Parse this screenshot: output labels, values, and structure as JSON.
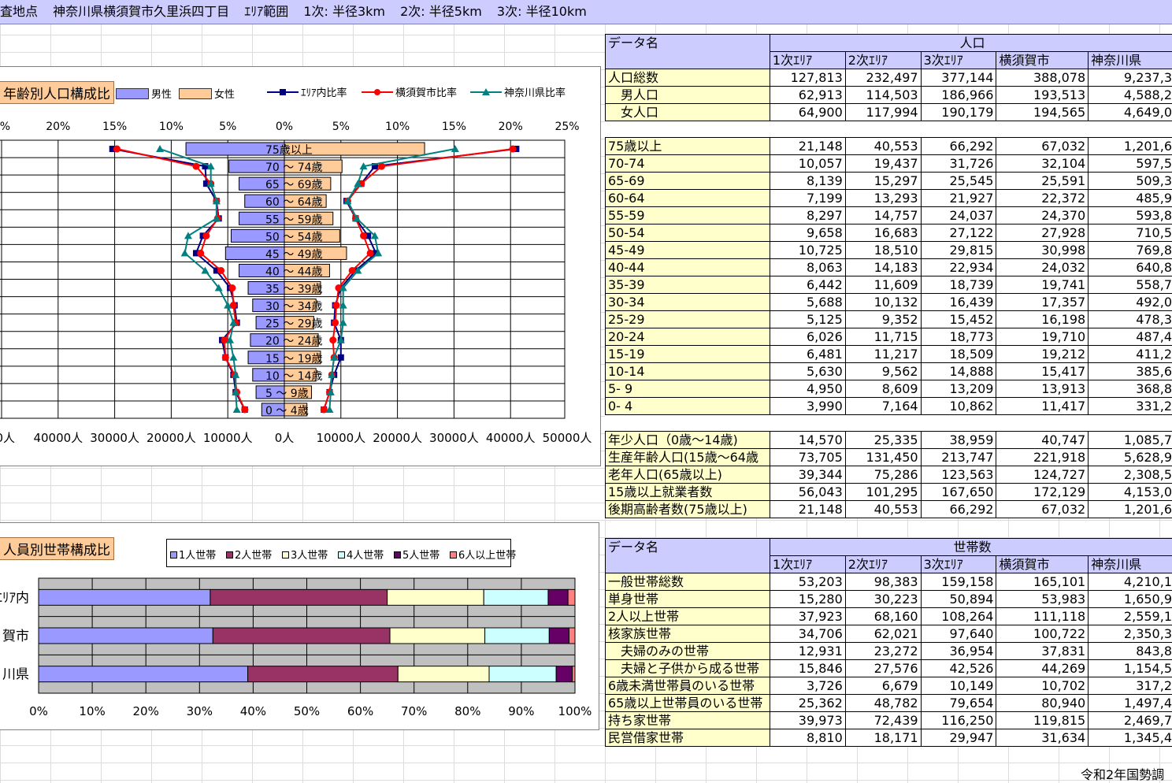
{
  "title": {
    "survey": "査地点",
    "location": "神奈川県横須賀市久里浜四丁目",
    "area_label": "ｴﾘｱ範囲",
    "r1": "1次: 半径3km",
    "r2": "2次: 半径5km",
    "r3": "3次: 半径10km"
  },
  "pyramid": {
    "tag": "年齢別人口構成比",
    "legend": {
      "male": "男性",
      "female": "女性",
      "area_ratio": "ｴﾘｱ内比率",
      "city_ratio": "横須賀市比率",
      "pref_ratio": "神奈川県比率"
    },
    "colors": {
      "male": "#9999ff",
      "female": "#ffcc99",
      "area": "#000080",
      "city": "#ff0000",
      "pref": "#008080"
    },
    "top_ticks": [
      "5%",
      "20%",
      "15%",
      "10%",
      "5%",
      "0%",
      "5%",
      "10%",
      "15%",
      "20%",
      "25%"
    ],
    "bottom_ticks": [
      "00人",
      "40000人",
      "30000人",
      "20000人",
      "10000人",
      "0人",
      "10000人",
      "20000人",
      "30000人",
      "40000人",
      "50000人"
    ],
    "age_labels": [
      "75歳以上",
      "70 ～ 74歳",
      "65 ～ 69歳",
      "60 ～ 64歳",
      "55 ～ 59歳",
      "50 ～ 54歳",
      "45 ～ 49歳",
      "40 ～ 44歳",
      "35 ～ 39歳",
      "30 ～ 34歳",
      "25 ～ 29歳",
      "20 ～ 24歳",
      "15 ～ 19歳",
      "10 ～ 14歳",
      "5 ～ 9歳",
      "0 ～ 4歳"
    ]
  },
  "chart_data": [
    {
      "type": "bar",
      "categories": [
        "75歳以上",
        "70 ～ 74歳",
        "65 ～ 69歳",
        "60 ～ 64歳",
        "55 ～ 59歳",
        "50 ～ 54歳",
        "45 ～ 49歳",
        "40 ～ 44歳",
        "35 ～ 39歳",
        "30 ～ 34歳",
        "25 ～ 29歳",
        "20 ～ 24歳",
        "15 ～ 19歳",
        "10 ～ 14歳",
        "5 ～ 9歳",
        "0 ～ 4歳"
      ],
      "series": [
        {
          "name": "男性",
          "values": [
            8700,
            4900,
            4000,
            3500,
            4000,
            4700,
            5200,
            4000,
            3200,
            2800,
            2500,
            3000,
            3200,
            2800,
            2500,
            2000
          ]
        },
        {
          "name": "女性",
          "values": [
            12400,
            5100,
            4100,
            3700,
            4300,
            4900,
            5500,
            4000,
            3200,
            2800,
            2600,
            3000,
            3200,
            2800,
            2400,
            2000
          ]
        },
        {
          "name": "ｴﾘｱ内比率",
          "values": [
            [
              -15.2,
              20.5
            ],
            [
              -7.0,
              8.0
            ],
            [
              -6.9,
              6.8
            ],
            [
              -6.0,
              5.5
            ],
            [
              -5.8,
              6.3
            ],
            [
              -7.2,
              7.4
            ],
            [
              -7.8,
              8.1
            ],
            [
              -6.0,
              6.3
            ],
            [
              -4.8,
              5.0
            ],
            [
              -4.4,
              4.5
            ],
            [
              -4.2,
              4.4
            ],
            [
              -5.5,
              5.0
            ],
            [
              -5.2,
              5.0
            ],
            [
              -4.5,
              4.4
            ],
            [
              -4.3,
              4.0
            ],
            [
              -3.5,
              3.5
            ]
          ]
        },
        {
          "name": "横須賀市比率",
          "values": [
            [
              -14.8,
              20.2
            ],
            [
              -7.8,
              8.6
            ],
            [
              -6.5,
              6.8
            ],
            [
              -6.0,
              5.6
            ],
            [
              -5.9,
              6.3
            ],
            [
              -6.9,
              7.0
            ],
            [
              -7.4,
              7.6
            ],
            [
              -5.6,
              6.0
            ],
            [
              -4.6,
              4.8
            ],
            [
              -4.5,
              4.6
            ],
            [
              -4.3,
              4.5
            ],
            [
              -5.3,
              4.3
            ],
            [
              -5.2,
              4.4
            ],
            [
              -4.4,
              4.2
            ],
            [
              -4.2,
              4.0
            ],
            [
              -3.5,
              3.5
            ]
          ]
        },
        {
          "name": "神奈川県比率",
          "values": [
            [
              -11.0,
              15.1
            ],
            [
              -6.5,
              7.0
            ],
            [
              -6.5,
              6.5
            ],
            [
              -6.0,
              5.6
            ],
            [
              -6.0,
              6.4
            ],
            [
              -8.5,
              8.0
            ],
            [
              -8.8,
              8.3
            ],
            [
              -7.0,
              6.5
            ],
            [
              -5.8,
              5.2
            ],
            [
              -5.0,
              5.2
            ],
            [
              -4.5,
              5.2
            ],
            [
              -4.8,
              5.0
            ],
            [
              -4.5,
              4.4
            ],
            [
              -4.3,
              4.2
            ],
            [
              -4.3,
              4.1
            ],
            [
              -4.2,
              4.0
            ]
          ]
        }
      ],
      "xlim": [
        -25,
        25
      ],
      "grid": true
    },
    {
      "type": "bar",
      "categories": [
        "ｴﾘｱ内",
        "賀市",
        "川県"
      ],
      "series": [
        {
          "name": "1人世帯",
          "values": [
            32,
            32.5,
            39
          ]
        },
        {
          "name": "2人世帯",
          "values": [
            33,
            33,
            28
          ]
        },
        {
          "name": "3人世帯",
          "values": [
            18,
            17.7,
            17
          ]
        },
        {
          "name": "4人世帯",
          "values": [
            12,
            12,
            12.5
          ]
        },
        {
          "name": "5人世帯",
          "values": [
            3.7,
            3.7,
            3
          ]
        },
        {
          "name": "6人以上世帯",
          "values": [
            1.3,
            1.1,
            0.5
          ]
        }
      ],
      "xlim": [
        0,
        100
      ],
      "stacked": true,
      "orientation": "horizontal"
    }
  ],
  "household_chart": {
    "tag": "人員別世帯構成比",
    "categories": [
      "ｴﾘｱ内",
      "賀市",
      "川県"
    ],
    "legend": [
      "1人世帯",
      "2人世帯",
      "3人世帯",
      "4人世帯",
      "5人世帯",
      "6人以上世帯"
    ],
    "colors": [
      "#9999ff",
      "#993366",
      "#ffffcc",
      "#ccffff",
      "#660066",
      "#ff8080"
    ],
    "ticks": [
      "0%",
      "10%",
      "20%",
      "30%",
      "40%",
      "50%",
      "60%",
      "70%",
      "80%",
      "90%",
      "100%"
    ]
  },
  "pop_table": {
    "data_name": "データ名",
    "group": "人口",
    "cols": [
      "1次ｴﾘｱ",
      "2次ｴﾘｱ",
      "3次ｴﾘｱ",
      "横須賀市",
      "神奈川県"
    ],
    "block1": [
      {
        "name": "人口総数",
        "v": [
          "127,813",
          "232,497",
          "377,144",
          "388,078",
          "9,237,3"
        ]
      },
      {
        "name": "　男人口",
        "v": [
          "62,913",
          "114,503",
          "186,966",
          "193,513",
          "4,588,2"
        ]
      },
      {
        "name": "　女人口",
        "v": [
          "64,900",
          "117,994",
          "190,179",
          "194,565",
          "4,649,0"
        ]
      }
    ],
    "block2": [
      {
        "name": "75歳以上",
        "v": [
          "21,148",
          "40,553",
          "66,292",
          "67,032",
          "1,201,6"
        ]
      },
      {
        "name": "70-74",
        "v": [
          "10,057",
          "19,437",
          "31,726",
          "32,104",
          "597,5"
        ]
      },
      {
        "name": "65-69",
        "v": [
          "8,139",
          "15,297",
          "25,545",
          "25,591",
          "509,3"
        ]
      },
      {
        "name": "60-64",
        "v": [
          "7,199",
          "13,293",
          "21,927",
          "22,372",
          "485,9"
        ]
      },
      {
        "name": "55-59",
        "v": [
          "8,297",
          "14,757",
          "24,037",
          "24,370",
          "593,8"
        ]
      },
      {
        "name": "50-54",
        "v": [
          "9,658",
          "16,683",
          "27,122",
          "27,928",
          "710,5"
        ]
      },
      {
        "name": "45-49",
        "v": [
          "10,725",
          "18,510",
          "29,815",
          "30,998",
          "769,8"
        ]
      },
      {
        "name": "40-44",
        "v": [
          "8,063",
          "14,183",
          "22,934",
          "24,032",
          "640,8"
        ]
      },
      {
        "name": "35-39",
        "v": [
          "6,442",
          "11,609",
          "18,739",
          "19,741",
          "558,7"
        ]
      },
      {
        "name": "30-34",
        "v": [
          "5,688",
          "10,132",
          "16,439",
          "17,357",
          "492,0"
        ]
      },
      {
        "name": "25-29",
        "v": [
          "5,125",
          "9,352",
          "15,452",
          "16,198",
          "478,3"
        ]
      },
      {
        "name": "20-24",
        "v": [
          "6,026",
          "11,715",
          "18,773",
          "19,710",
          "487,4"
        ]
      },
      {
        "name": "15-19",
        "v": [
          "6,481",
          "11,217",
          "18,509",
          "19,212",
          "411,2"
        ]
      },
      {
        "name": "10-14",
        "v": [
          "5,630",
          "9,562",
          "14,888",
          "15,417",
          "385,6"
        ]
      },
      {
        "name": " 5- 9",
        "v": [
          "4,950",
          "8,609",
          "13,209",
          "13,913",
          "368,8"
        ]
      },
      {
        "name": " 0- 4",
        "v": [
          "3,990",
          "7,164",
          "10,862",
          "11,417",
          "331,2"
        ]
      }
    ],
    "block3": [
      {
        "name": "年少人口（0歳～14歳)",
        "v": [
          "14,570",
          "25,335",
          "38,959",
          "40,747",
          "1,085,7"
        ]
      },
      {
        "name": "生産年齢人口(15歳～64歳",
        "v": [
          "73,705",
          "131,450",
          "213,747",
          "221,918",
          "5,628,9"
        ]
      },
      {
        "name": "老年人口(65歳以上)",
        "v": [
          "39,344",
          "75,286",
          "123,563",
          "124,727",
          "2,308,5"
        ]
      },
      {
        "name": "15歳以上就業者数",
        "v": [
          "56,043",
          "101,295",
          "167,650",
          "172,129",
          "4,153,0"
        ]
      },
      {
        "name": "後期高齢者数(75歳以上)",
        "v": [
          "21,148",
          "40,553",
          "66,292",
          "67,032",
          "1,201,6"
        ]
      }
    ]
  },
  "hh_table": {
    "data_name": "データ名",
    "group": "世帯数",
    "cols": [
      "1次ｴﾘｱ",
      "2次ｴﾘｱ",
      "3次ｴﾘｱ",
      "横須賀市",
      "神奈川県"
    ],
    "rows": [
      {
        "name": "一般世帯総数",
        "v": [
          "53,203",
          "98,383",
          "159,158",
          "165,101",
          "4,210,1"
        ]
      },
      {
        "name": "単身世帯",
        "v": [
          "15,280",
          "30,223",
          "50,894",
          "53,983",
          "1,650,9"
        ]
      },
      {
        "name": "2人以上世帯",
        "v": [
          "37,923",
          "68,160",
          "108,264",
          "111,118",
          "2,559,1"
        ]
      },
      {
        "name": "核家族世帯",
        "v": [
          "34,706",
          "62,021",
          "97,640",
          "100,722",
          "2,350,3"
        ]
      },
      {
        "name": "　夫婦のみの世帯",
        "v": [
          "12,931",
          "23,272",
          "36,954",
          "37,831",
          "843,8"
        ]
      },
      {
        "name": "　夫婦と子供から成る世帯",
        "v": [
          "15,846",
          "27,576",
          "42,526",
          "44,269",
          "1,154,5"
        ]
      },
      {
        "name": "6歳未満世帯員のいる世帯",
        "v": [
          "3,726",
          "6,679",
          "10,149",
          "10,702",
          "317,2"
        ]
      },
      {
        "name": "65歳以上世帯員のいる世帯",
        "v": [
          "25,362",
          "48,782",
          "79,654",
          "80,940",
          "1,497,4"
        ]
      },
      {
        "name": "持ち家世帯",
        "v": [
          "39,973",
          "72,439",
          "116,250",
          "119,815",
          "2,469,7"
        ]
      },
      {
        "name": "民営借家世帯",
        "v": [
          "8,810",
          "18,171",
          "29,947",
          "31,634",
          "1,345,4"
        ]
      }
    ]
  },
  "footer": "令和2年国勢調"
}
